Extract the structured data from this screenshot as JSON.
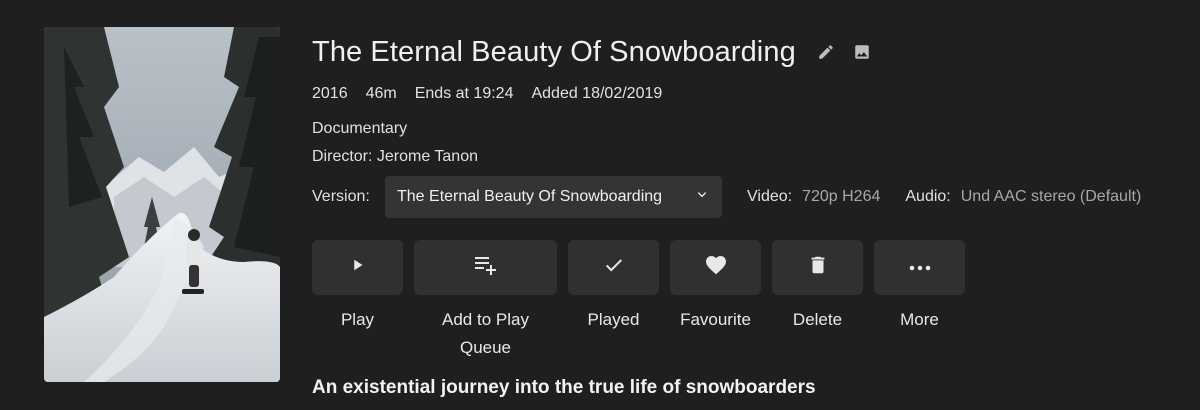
{
  "movie": {
    "title": "The Eternal Beauty Of Snowboarding",
    "year": "2016",
    "runtime": "46m",
    "ends_at": "Ends at 19:24",
    "added": "Added 18/02/2019",
    "genre": "Documentary",
    "director": "Director: Jerome Tanon",
    "tagline": "An existential journey into the true life of snowboarders"
  },
  "version": {
    "label": "Version:",
    "selected": "The Eternal Beauty Of Snowboarding"
  },
  "streams": {
    "video_label": "Video:",
    "video_value": "720p H264",
    "audio_label": "Audio:",
    "audio_value": "Und AAC stereo (Default)"
  },
  "actions": {
    "play": "Play",
    "add_queue_line1": "Add to Play",
    "add_queue_line2": "Queue",
    "played": "Played",
    "favourite": "Favourite",
    "delete": "Delete",
    "more": "More"
  },
  "icons": {
    "edit": "pencil-icon",
    "image": "image-icon",
    "play": "play-icon",
    "queue": "playlist-add-icon",
    "played": "check-icon",
    "favourite": "heart-icon",
    "delete": "trash-icon",
    "more": "more-horizontal-icon",
    "dropdown": "chevron-down-icon"
  },
  "colors": {
    "background": "#1f1f1f",
    "button": "#303030",
    "select": "#343434",
    "muted_text": "#a8a8a8"
  }
}
